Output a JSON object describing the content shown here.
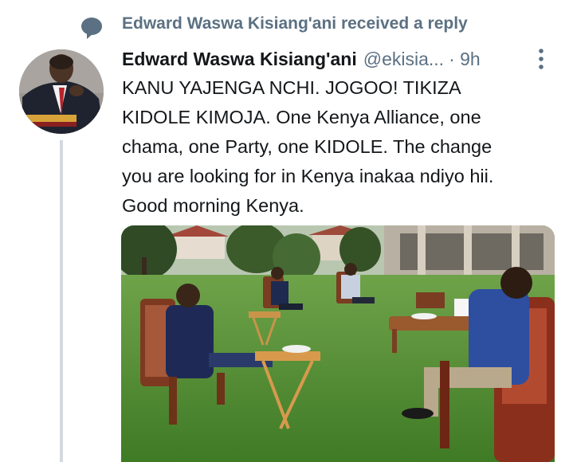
{
  "context": {
    "text": "Edward Waswa Kisiang'ani received a reply",
    "icon": "speech-bubble-icon"
  },
  "tweet": {
    "author_name": "Edward Waswa Kisiang'ani",
    "handle": "@ekisia...",
    "time": "· 9h",
    "lines": [
      "KANU YAJENGA NCHI. JOGOO! TIKIZA",
      "KIDOLE  KIMOJA. One Kenya Alliance, one",
      "chama, one Party, one KIDOLE. The change",
      "you are looking for in Kenya inakaa ndiyo hii.",
      "Good morning Kenya."
    ],
    "more_icon": "more-vertical-icon"
  },
  "colors": {
    "primary_text": "#14171a",
    "secondary_text": "#5b7083",
    "thread_line": "#d3d9de"
  }
}
